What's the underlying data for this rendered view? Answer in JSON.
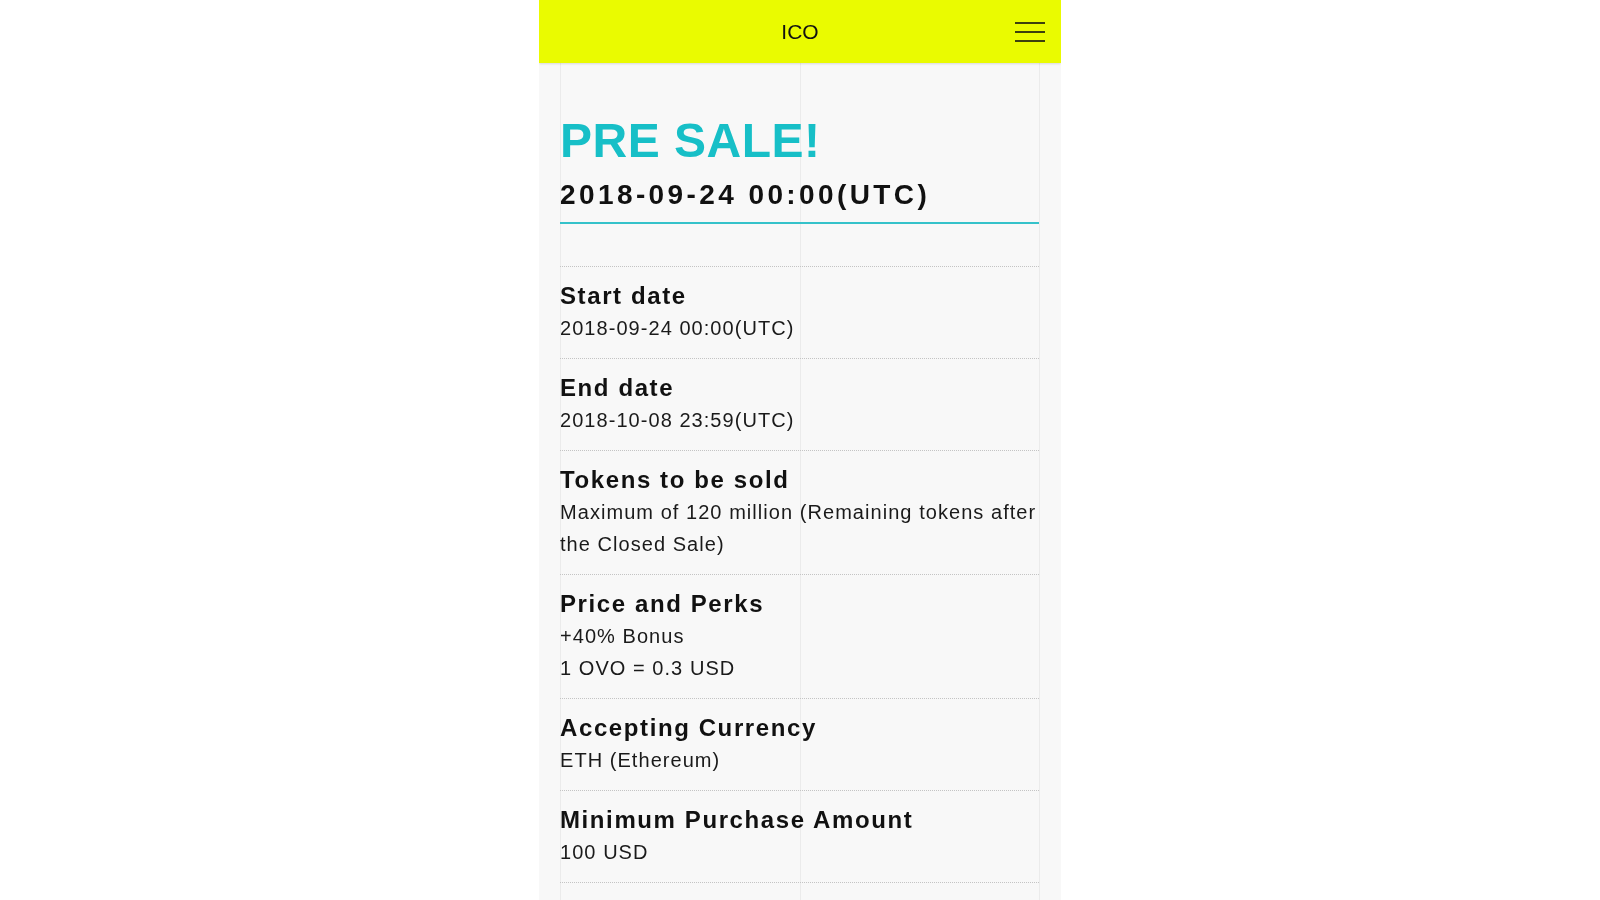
{
  "header": {
    "title": "ICO"
  },
  "hero": {
    "title": "PRE SALE!",
    "date": "2018-09-24 00:00(UTC)"
  },
  "details": [
    {
      "label": "Start date",
      "values": [
        "2018-09-24 00:00(UTC)"
      ]
    },
    {
      "label": "End date",
      "values": [
        "2018-10-08 23:59(UTC)"
      ]
    },
    {
      "label": "Tokens to be sold",
      "values": [
        "Maximum of 120 million (Remaining tokens after the Closed Sale)"
      ]
    },
    {
      "label": "Price and Perks",
      "values": [
        "+40% Bonus",
        "1 OVO = 0.3 USD"
      ]
    },
    {
      "label": "Accepting Currency",
      "values": [
        "ETH (Ethereum)"
      ]
    },
    {
      "label": "Minimum Purchase Amount",
      "values": [
        "100 USD"
      ]
    }
  ]
}
